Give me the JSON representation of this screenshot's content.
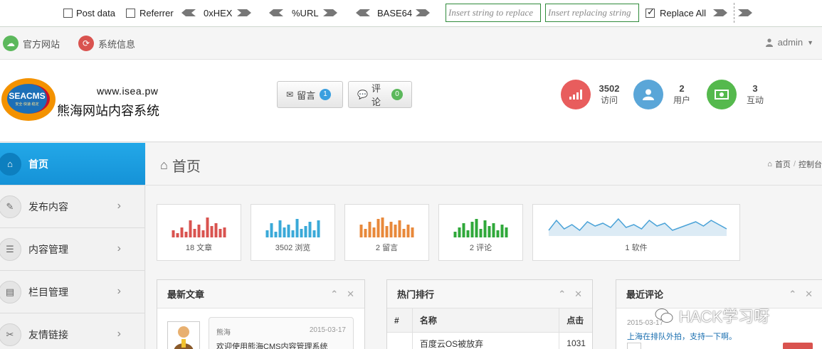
{
  "hackbar": {
    "post_data": "Post data",
    "referrer": "Referrer",
    "hex": "0xHEX",
    "url": "%URL",
    "base64": "BASE64",
    "find_placeholder": "Insert string to replace",
    "replace_placeholder": "Insert replacing string",
    "replace_all": "Replace All"
  },
  "topnav": {
    "official_site": "官方网站",
    "system_info": "系统信息",
    "user": "admin"
  },
  "brand": {
    "logo_text": "SEACMS",
    "logo_sub": "安全·快速·稳定",
    "url": "www.isea.pw",
    "name": "熊海网站内容系统"
  },
  "header_buttons": [
    {
      "label": "留言",
      "count": "1",
      "color": "#3a9fdf"
    },
    {
      "label": "评论",
      "count": "0",
      "color": "#5cb85c"
    }
  ],
  "stats": [
    {
      "value": "3502",
      "label": "访问",
      "color": "#e85d5d",
      "icon": "signal-icon"
    },
    {
      "value": "2",
      "label": "用户",
      "color": "#5aa6d8",
      "icon": "user-icon"
    },
    {
      "value": "3",
      "label": "互动",
      "color": "#55b94d",
      "icon": "money-icon"
    }
  ],
  "sidebar": {
    "items": [
      {
        "label": "首页",
        "name": "home"
      },
      {
        "label": "发布内容",
        "name": "publish"
      },
      {
        "label": "内容管理",
        "name": "content"
      },
      {
        "label": "栏目管理",
        "name": "columns"
      },
      {
        "label": "友情链接",
        "name": "links"
      }
    ]
  },
  "page": {
    "title": "首页",
    "breadcrumb_home": "首页",
    "breadcrumb_current": "控制台"
  },
  "tiles": [
    {
      "label": "18 文章",
      "color": "#d9534f"
    },
    {
      "label": "3502 浏览",
      "color": "#3aa9d8"
    },
    {
      "label": "2 留言",
      "color": "#e8883a"
    },
    {
      "label": "2 评论",
      "color": "#2fa83a"
    },
    {
      "label": "1 软件",
      "color": "#4ba3d8"
    }
  ],
  "widgets": {
    "latest_articles": {
      "title": "最新文章",
      "author": "熊海",
      "date": "2015-03-17",
      "text": "欢迎使用熊海CMS内容管理系统"
    },
    "hot_ranking": {
      "title": "热门排行",
      "col_num": "#",
      "col_name": "名称",
      "col_clicks": "点击",
      "row_name": "百度云OS被放弃",
      "row_clicks": "1031"
    },
    "latest_comments": {
      "title": "最近评论",
      "date": "2015-03-17",
      "text": "上海在排队外拍，支持一下啊。"
    }
  },
  "watermark": "HACK学习呀"
}
